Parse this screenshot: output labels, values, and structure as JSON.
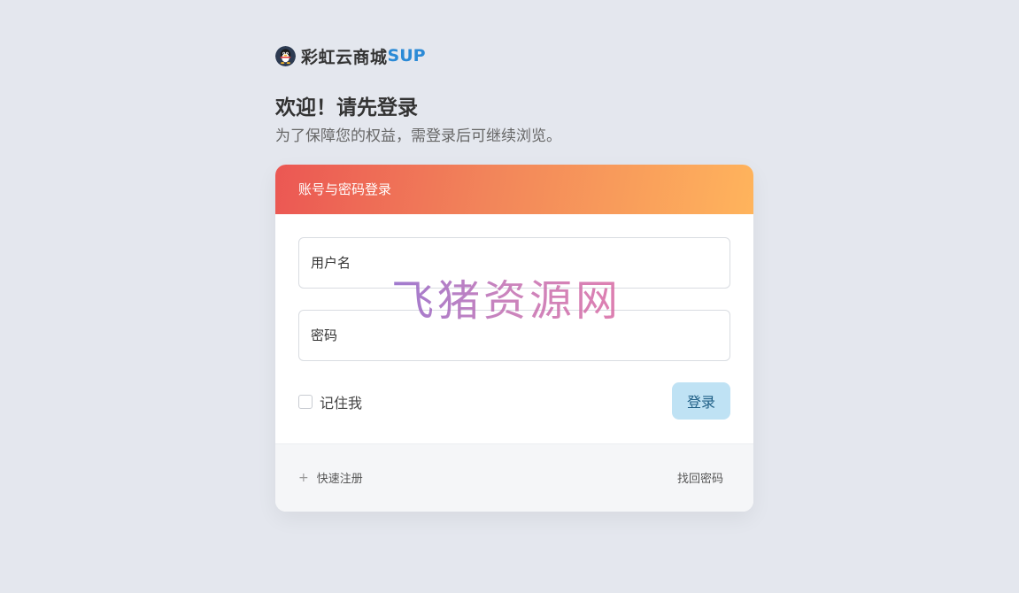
{
  "brand": {
    "name": "彩虹云商城",
    "suffix": "SUP",
    "logo_icon": "penguin-logo-icon"
  },
  "welcome": {
    "title": "欢迎！请先登录",
    "subtitle": "为了保障您的权益，需登录后可继续浏览。"
  },
  "login_card": {
    "header": "账号与密码登录",
    "username_placeholder": "用户名",
    "password_placeholder": "密码",
    "remember_label": "记住我",
    "login_button": "登录",
    "register_link": "快速注册",
    "register_icon": "plus-icon",
    "find_password_link": "找回密码"
  },
  "watermark": "飞猪资源网",
  "colors": {
    "background": "#e4e7ee",
    "header_gradient_start": "#eb5753",
    "header_gradient_end": "#ffb45c",
    "login_button_bg": "#bfe2f4",
    "brand_accent": "#2b8ad6"
  }
}
